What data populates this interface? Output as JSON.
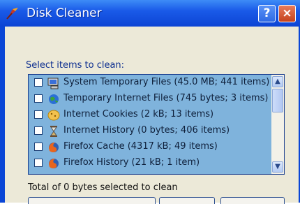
{
  "window": {
    "title": "Disk Cleaner",
    "help_label": "?",
    "close_label": "×"
  },
  "prompt": "Select items to clean:",
  "items": [
    {
      "label": "System Temporary Files (45.0 MB; 441 items)",
      "icon": "computer-icon",
      "checked": false
    },
    {
      "label": "Temporary Internet Files (745 bytes; 3 items)",
      "icon": "internet-globe-icon",
      "checked": false
    },
    {
      "label": "Internet Cookies (2 kB; 13 items)",
      "icon": "cookie-icon",
      "checked": false
    },
    {
      "label": "Internet History (0 bytes; 406 items)",
      "icon": "hourglass-icon",
      "checked": false
    },
    {
      "label": "Firefox Cache (4317 kB; 49 items)",
      "icon": "firefox-icon",
      "checked": false
    },
    {
      "label": "Firefox History (21 kB; 1 item)",
      "icon": "firefox-icon",
      "checked": false
    }
  ],
  "scrollbar": {
    "up": "▲",
    "down": "▼"
  },
  "status_text": "Total of 0 bytes selected to clean",
  "colors": {
    "list_background": "#7fb3dc",
    "titlebar": "#0c44d4",
    "close_button": "#c5421c"
  }
}
